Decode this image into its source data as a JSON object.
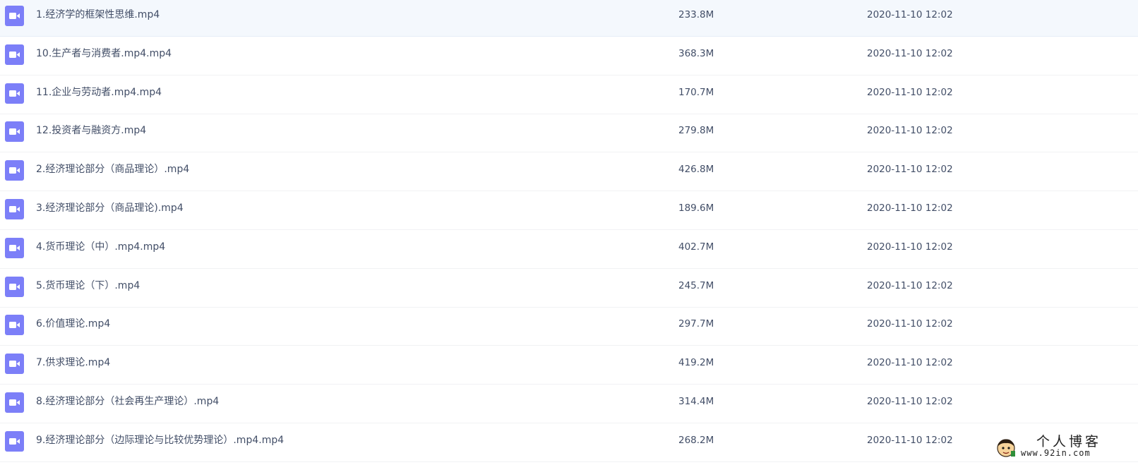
{
  "colors": {
    "icon_bg": "#7c7ff8",
    "text": "#424e67",
    "selected_row_bg": "#f4f8fd"
  },
  "files": [
    {
      "name": "1.经济学的框架性思维.mp4",
      "size": "233.8M",
      "date": "2020-11-10 12:02",
      "icon": "video-file-icon"
    },
    {
      "name": "10.生产者与消费者.mp4.mp4",
      "size": "368.3M",
      "date": "2020-11-10 12:02",
      "icon": "video-file-icon"
    },
    {
      "name": "11.企业与劳动者.mp4.mp4",
      "size": "170.7M",
      "date": "2020-11-10 12:02",
      "icon": "video-file-icon"
    },
    {
      "name": "12.投资者与融资方.mp4",
      "size": "279.8M",
      "date": "2020-11-10 12:02",
      "icon": "video-file-icon"
    },
    {
      "name": "2.经济理论部分（商品理论）.mp4",
      "size": "426.8M",
      "date": "2020-11-10 12:02",
      "icon": "video-file-icon"
    },
    {
      "name": "3.经济理论部分（商品理论).mp4",
      "size": "189.6M",
      "date": "2020-11-10 12:02",
      "icon": "video-file-icon"
    },
    {
      "name": "4.货币理论（中）.mp4.mp4",
      "size": "402.7M",
      "date": "2020-11-10 12:02",
      "icon": "video-file-icon"
    },
    {
      "name": "5.货币理论（下）.mp4",
      "size": "245.7M",
      "date": "2020-11-10 12:02",
      "icon": "video-file-icon"
    },
    {
      "name": "6.价值理论.mp4",
      "size": "297.7M",
      "date": "2020-11-10 12:02",
      "icon": "video-file-icon"
    },
    {
      "name": "7.供求理论.mp4",
      "size": "419.2M",
      "date": "2020-11-10 12:02",
      "icon": "video-file-icon"
    },
    {
      "name": "8.经济理论部分（社会再生产理论）.mp4",
      "size": "314.4M",
      "date": "2020-11-10 12:02",
      "icon": "video-file-icon"
    },
    {
      "name": "9.经济理论部分（边际理论与比较优势理论）.mp4.mp4",
      "size": "268.2M",
      "date": "2020-11-10 12:02",
      "icon": "video-file-icon"
    }
  ],
  "watermark": {
    "title": "个人博客",
    "url": "www.92in.com"
  }
}
